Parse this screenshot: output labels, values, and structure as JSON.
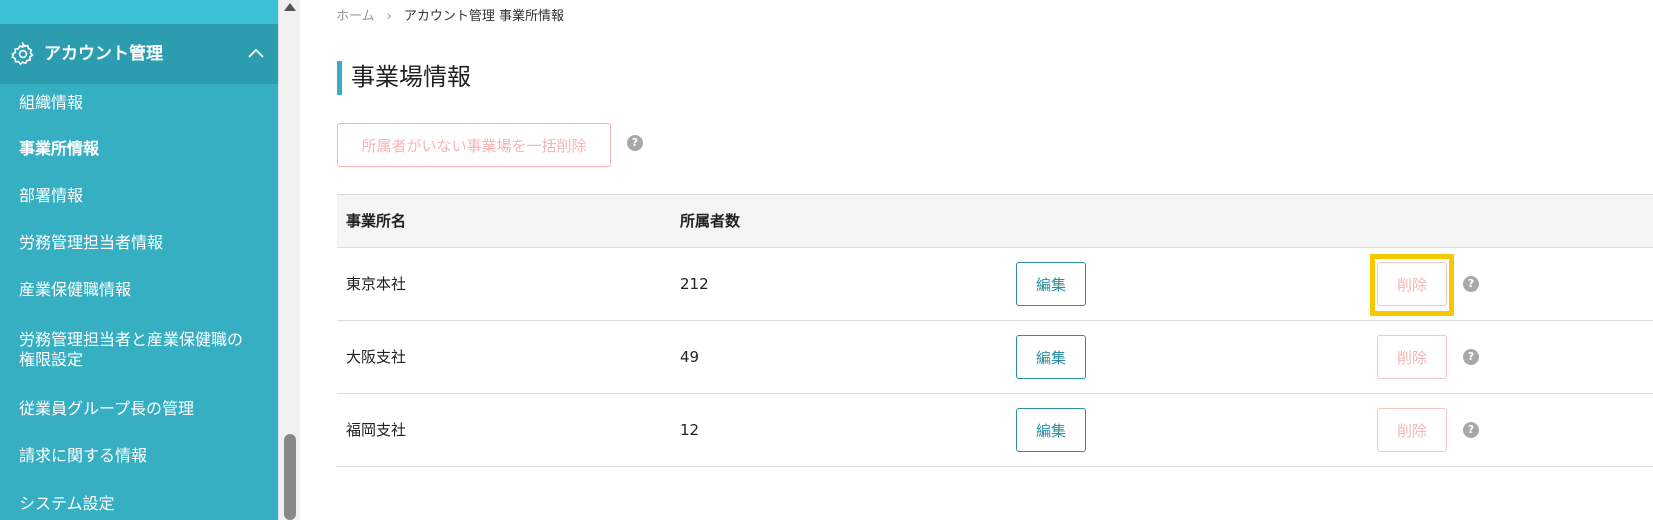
{
  "sidebar": {
    "section_title": "アカウント管理",
    "items": [
      {
        "label": "組織情報",
        "active": false
      },
      {
        "label": "事業所情報",
        "active": true
      },
      {
        "label": "部署情報",
        "active": false
      },
      {
        "label": "労務管理担当者情報",
        "active": false
      },
      {
        "label": "産業保健職情報",
        "active": false
      },
      {
        "label": "労務管理担当者と産業保健職の",
        "label2": "権限設定",
        "active": false
      },
      {
        "label": "従業員グループ長の管理",
        "active": false
      },
      {
        "label": "請求に関する情報",
        "active": false
      },
      {
        "label": "システム設定",
        "active": false
      }
    ],
    "colors": {
      "background": "#36afc3",
      "header": "#2c9daf"
    }
  },
  "breadcrumb": {
    "home": "ホーム",
    "separator": "›",
    "current": "アカウント管理 事業所情報"
  },
  "page": {
    "title": "事業場情報",
    "bulk_delete_label": "所属者がいない事業場を一括削除",
    "help_glyph": "?"
  },
  "table": {
    "headers": {
      "name": "事業所名",
      "members": "所属者数"
    },
    "rows": [
      {
        "name": "東京本社",
        "members": "212",
        "edit_label": "編集",
        "delete_label": "削除",
        "highlighted": true
      },
      {
        "name": "大阪支社",
        "members": "49",
        "edit_label": "編集",
        "delete_label": "削除",
        "highlighted": false
      },
      {
        "name": "福岡支社",
        "members": "12",
        "edit_label": "編集",
        "delete_label": "削除",
        "highlighted": false
      }
    ]
  },
  "icons": {
    "section": "gear-icon",
    "collapse": "chevron-up-icon",
    "help": "question-circle-icon"
  },
  "colors": {
    "accent": "#36afc3",
    "edit": "#2a8fa0",
    "delete_disabled": "#f4b6b6",
    "highlight": "#f5c800"
  }
}
